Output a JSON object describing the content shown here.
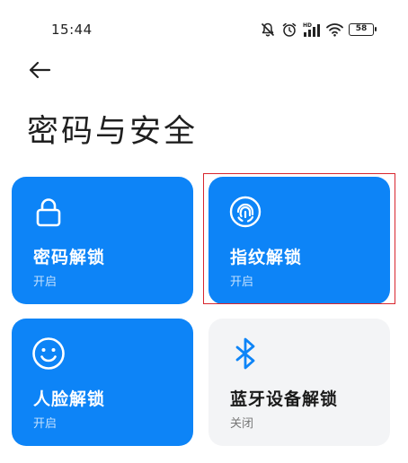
{
  "status_bar": {
    "time": "15:44",
    "icons": [
      "silent-icon",
      "alarm-icon",
      "signal-icon",
      "wifi-icon",
      "battery-icon"
    ],
    "network_label": "HD",
    "battery_level": "58"
  },
  "header": {
    "back_icon": "arrow-left-icon",
    "title": "密码与安全"
  },
  "tiles": [
    {
      "label": "密码解锁",
      "status": "开启",
      "icon": "lock-icon",
      "enabled": true
    },
    {
      "label": "指纹解锁",
      "status": "开启",
      "icon": "fingerprint-icon",
      "enabled": true,
      "highlighted": true
    },
    {
      "label": "人脸解锁",
      "status": "开启",
      "icon": "smiley-face-icon",
      "enabled": true
    },
    {
      "label": "蓝牙设备解锁",
      "status": "关闭",
      "icon": "bluetooth-icon",
      "enabled": false
    }
  ],
  "colors": {
    "tile_on": "#0d84f7",
    "tile_off": "#f3f4f6",
    "highlight": "#d8262e"
  }
}
